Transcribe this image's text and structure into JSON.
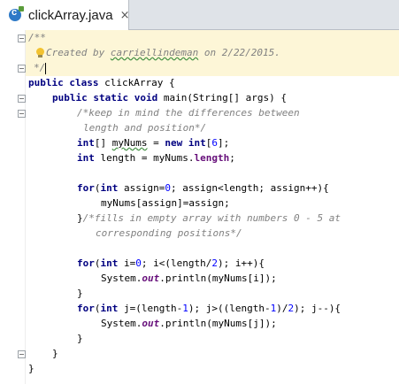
{
  "tab": {
    "title": "clickArray.java",
    "close": "×",
    "icon": "java-class-icon"
  },
  "editor": {
    "lines": [
      [
        "/**"
      ],
      [
        "Created by ",
        "carriellindeman",
        " on 2/22/2015."
      ],
      [
        "*/"
      ],
      [
        "public",
        " ",
        "class",
        " clickArray {"
      ],
      [
        "public",
        " ",
        "static",
        " ",
        "void",
        " main(String[] args) {"
      ],
      [
        "/*keep in mind the differences between"
      ],
      [
        "length and position*/"
      ],
      [
        "int",
        "[] ",
        "myNums",
        " = ",
        "new",
        " ",
        "int",
        "[",
        "6",
        "];"
      ],
      [
        "int",
        " length = myNums.",
        "length",
        ";"
      ],
      [
        ""
      ],
      [
        "for",
        "(",
        "int",
        " assign=",
        "0",
        "; assign<length; assign++){"
      ],
      [
        "myNums[assign]=assign;"
      ],
      [
        "}",
        "/*fills in empty array with numbers 0 - 5 at"
      ],
      [
        "corresponding positions*/"
      ],
      [
        ""
      ],
      [
        "for",
        "(",
        "int",
        " i=",
        "0",
        "; i<(length/",
        "2",
        "); i++){"
      ],
      [
        "System.",
        "out",
        ".println(myNums[i]);"
      ],
      [
        "}"
      ],
      [
        "for",
        "(",
        "int",
        " j=(length-",
        "1",
        "); j>((length-",
        "1",
        ")/",
        "2",
        "); j--){"
      ],
      [
        "System.",
        "out",
        ".println(myNums[j]);"
      ],
      [
        "}"
      ],
      [
        "}"
      ],
      [
        "}"
      ]
    ]
  }
}
